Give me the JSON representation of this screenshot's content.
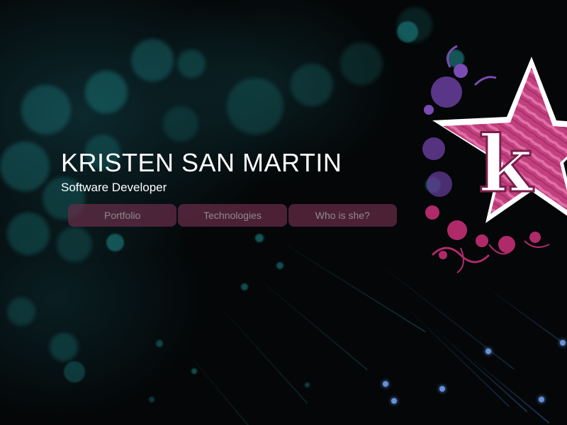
{
  "header": {
    "title": "KRISTEN SAN MARTIN",
    "subtitle": "Software Developer"
  },
  "nav": {
    "items": [
      {
        "label": "Portfolio"
      },
      {
        "label": "Technologies"
      },
      {
        "label": "Who is she?"
      }
    ]
  },
  "logo": {
    "letter": "k",
    "colors": {
      "star_fill": "#c2407e",
      "star_stripe": "#e070a8",
      "star_outline": "#ffffff",
      "splatter_purple": "#6a3fa0",
      "splatter_magenta": "#b02a6a"
    }
  },
  "theme": {
    "background": "#040607",
    "bokeh": "#1f8a8c",
    "nav_bg": "#682c48",
    "nav_text": "#8f8a8e"
  }
}
